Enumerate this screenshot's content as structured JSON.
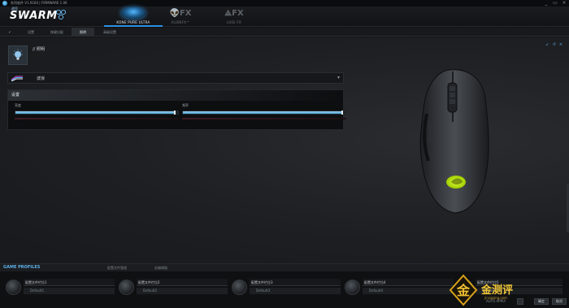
{
  "window": {
    "title": "系列软件 V1.9160 | FIRMWARE 1.06",
    "controls": [
      "_",
      "▭",
      "×"
    ]
  },
  "header": {
    "logo_small": "战豆",
    "logo_main": "SWARM",
    "devices": [
      {
        "label": "KONE PURE ULTRA",
        "active": true
      },
      {
        "label": "ALIENFX™",
        "active": false
      },
      {
        "label": "LOGI FX",
        "active": false
      }
    ]
  },
  "nav": {
    "tabs": [
      "✔",
      "设置",
      "按键分配",
      "照明",
      "高级设置"
    ],
    "active_index": 3
  },
  "section": {
    "title": "// 照明",
    "controls": [
      "↙",
      "↺",
      "×"
    ]
  },
  "lighting": {
    "effect_selected": "波浪",
    "settings_title": "设置",
    "sliders": [
      {
        "label": "亮度",
        "value": 0.98
      },
      {
        "label": "频率",
        "value": 0.98
      }
    ]
  },
  "profiles": {
    "title": "GAME PROFILES",
    "tabs": [
      "配置文件管理",
      "宏编辑器"
    ],
    "slots": [
      {
        "name": "配置文件栏位1",
        "sub": "Default1"
      },
      {
        "name": "配置文件栏位2",
        "sub": "Default2"
      },
      {
        "name": "配置文件栏位3",
        "sub": "Default3"
      },
      {
        "name": "配置文件栏位4",
        "sub": "Default4"
      },
      {
        "name": "配置文件栏位5",
        "sub": "Default5"
      }
    ],
    "auto_apply": "AUTO APPLY",
    "apply_label": "确定",
    "cancel_label": "取消"
  },
  "watermark": {
    "brand": "金测评",
    "url": "jinceping.com"
  },
  "colors": {
    "accent": "#2d8fe0",
    "mouse_logo": "#c8f000"
  }
}
